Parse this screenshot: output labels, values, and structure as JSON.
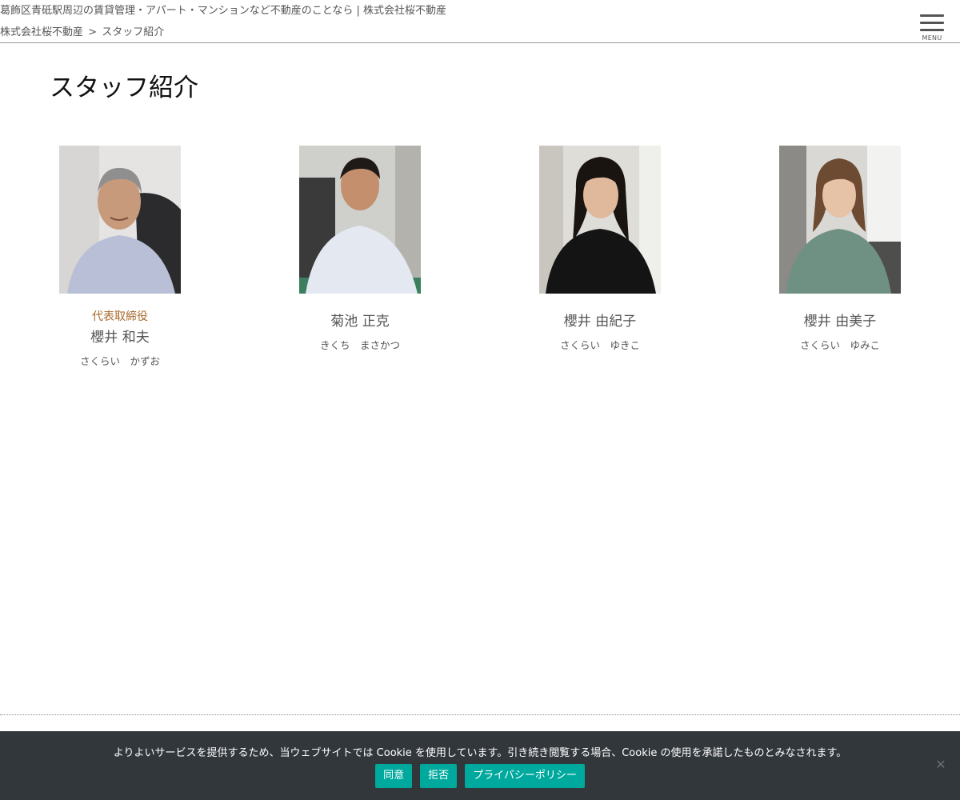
{
  "header": {
    "site_title": "葛飾区青砥駅周辺の賃貸管理・アパート・マンションなど不動産のことなら | 株式会社桜不動産",
    "breadcrumb": {
      "home": "株式会社桜不動産",
      "separator": ">",
      "current": "スタッフ紹介"
    },
    "menu_label": "MENU"
  },
  "page_title": "スタッフ紹介",
  "staff": [
    {
      "role": "代表取締役",
      "name": "櫻井 和夫",
      "kana": "さくらい　かずお"
    },
    {
      "role": "",
      "name": "菊池 正克",
      "kana": "きくち　まさかつ"
    },
    {
      "role": "",
      "name": "櫻井 由紀子",
      "kana": "さくらい　ゆきこ"
    },
    {
      "role": "",
      "name": "櫻井 由美子",
      "kana": "さくらい　ゆみこ"
    }
  ],
  "cookie_banner": {
    "message": "よりよいサービスを提供するため、当ウェブサイトでは Cookie を使用しています。引き続き閲覧する場合、Cookie の使用を承諾したものとみなされます。",
    "accept_label": "同意",
    "reject_label": "拒否",
    "privacy_label": "プライバシーポリシー",
    "close_icon": "close-icon"
  },
  "colors": {
    "role_accent": "#a8692a",
    "cookie_bg": "#32373c",
    "cookie_button": "#00a99d"
  }
}
